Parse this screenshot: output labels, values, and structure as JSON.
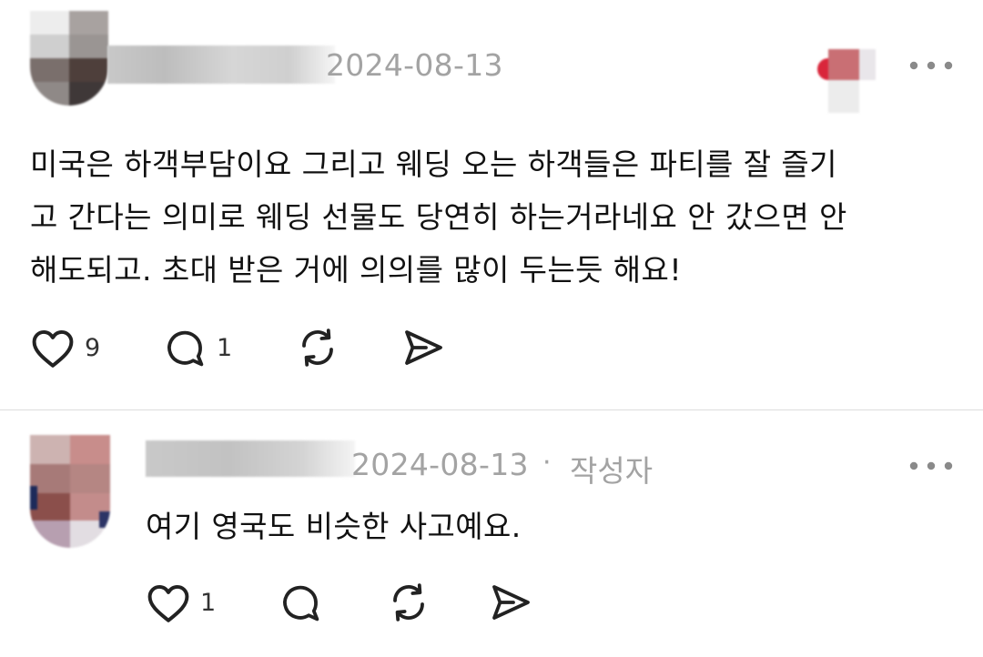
{
  "post": {
    "date": "2024-08-13",
    "lines": [
      "미국은 하객부담이요 그리고 웨딩 오는 하객들은 파티를 잘 즐기",
      "고 간다는 의미로 웨딩 선물도 당연히 하는거라네요 안 갔으면 안",
      "해도되고. 초대 받은 거에 의의를 많이 두는듯 해요!"
    ],
    "like_count": "9",
    "reply_count": "1"
  },
  "reply": {
    "date": "2024-08-13",
    "separator": "·",
    "author_label": "작성자",
    "text": "여기 영국도 비슷한 사고예요.",
    "like_count": "1"
  },
  "icons": [
    "heart-icon",
    "comment-icon",
    "repost-icon",
    "share-icon",
    "more-icon"
  ],
  "colors": {
    "text": "#111111",
    "muted": "#a3a3a3",
    "divider": "#dcdcdc",
    "icon": "#222222"
  }
}
